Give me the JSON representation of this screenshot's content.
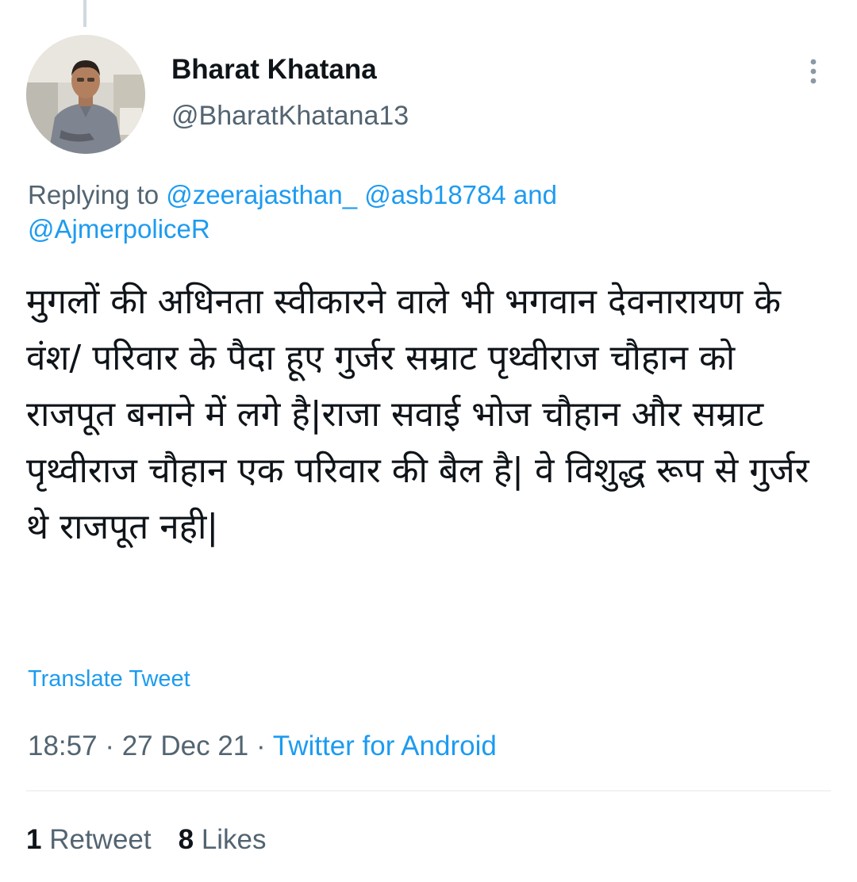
{
  "author": {
    "name": "Bharat Khatana",
    "handle": "@BharatKhatana13"
  },
  "reply": {
    "prefix": "Replying to ",
    "mention1": "@zeerajasthan_",
    "mention2": "@asb18784",
    "joiner": " and ",
    "mention3": "@AjmerpoliceR"
  },
  "tweet": {
    "text": "मुगलों की अधिनता स्वीकारने वाले भी भगवान देवनारायण के वंश/ परिवार के पैदा हूए गुर्जर सम्राट पृथ्वीराज चौहान को  राजपूत बनाने में लगे है|राजा सवाई भोज चौहान और सम्राट पृथ्वीराज चौहान एक परिवार की बैल है| वे विशुद्ध रूप से गुर्जर थे राजपूत नही|",
    "translate_label": "Translate Tweet"
  },
  "meta": {
    "time": "18:57",
    "sep1": " · ",
    "date": "27 Dec 21",
    "sep2": " · ",
    "source": "Twitter for Android"
  },
  "stats": {
    "retweet_count": "1",
    "retweet_label": "Retweet",
    "like_count": "8",
    "like_label": "Likes"
  },
  "icons": {
    "more": "more-vertical-icon",
    "avatar": "profile-photo"
  },
  "colors": {
    "link": "#1d9bf0",
    "secondary_text": "#536471",
    "primary_text": "#0f1419",
    "divider": "#eff3f4",
    "thread_line": "#cfd9de"
  }
}
